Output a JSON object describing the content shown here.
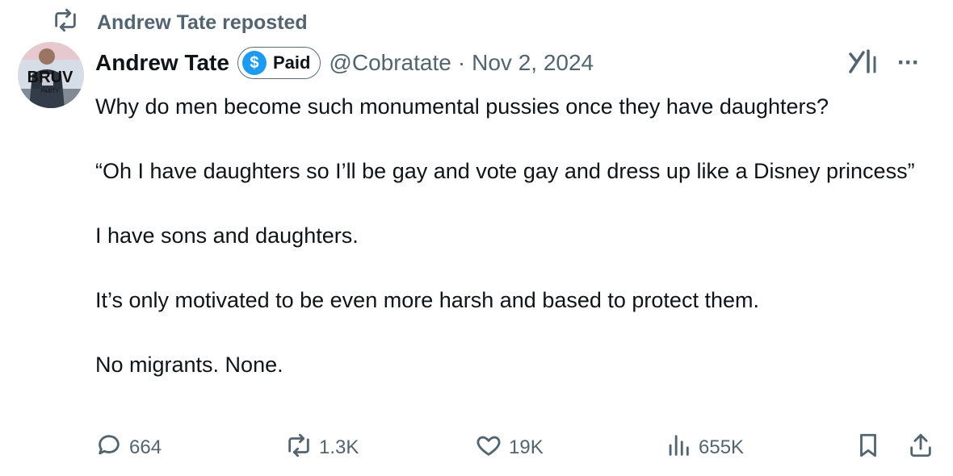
{
  "repost_header": {
    "text": "Andrew Tate reposted",
    "icon": "repost-icon"
  },
  "author": {
    "display_name": "Andrew Tate",
    "badge_label": "Paid",
    "badge_symbol": "$",
    "handle": "@Cobratate",
    "separator": "·",
    "date": "Nov 2, 2024",
    "avatar": {
      "icon": "avatar-image",
      "text_main": "BRUV",
      "text_sub": "PARTY"
    }
  },
  "header_icons": {
    "grok": "grok-icon",
    "more": "···"
  },
  "tweet_lines": {
    "p1": "Why do men become such monumental pussies once they have daughters?",
    "p2": "“Oh I have daughters so I’ll be gay and vote gay and dress up like a Disney princess”",
    "p3": "I have sons and daughters.",
    "p4": "It’s only motivated to be even more harsh and based to protect them.",
    "p5": "No migrants. None."
  },
  "actions": {
    "reply_count": "664",
    "repost_count": "1.3K",
    "like_count": "19K",
    "view_count": "655K"
  },
  "colors": {
    "text_primary": "#0f1419",
    "text_secondary": "#536471",
    "accent_blue": "#1d9bf0",
    "background": "#ffffff"
  }
}
